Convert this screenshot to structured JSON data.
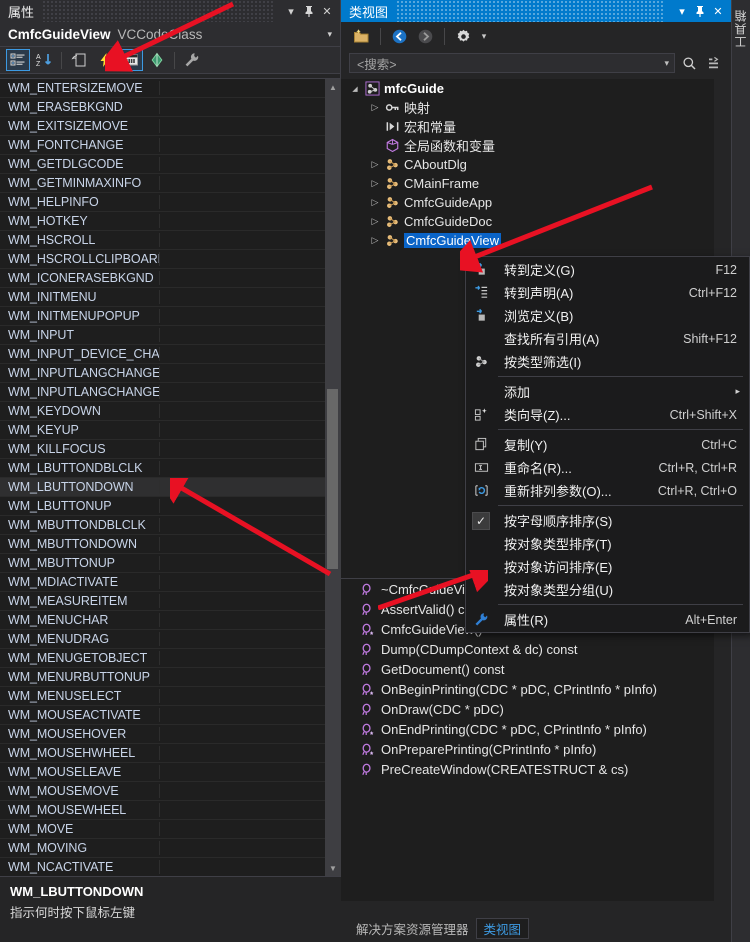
{
  "properties_pane": {
    "title": "属性",
    "titlebar_buttons": [
      {
        "name": "dropdown",
        "glyph": "▾"
      },
      {
        "name": "pin",
        "glyph": "⚲"
      },
      {
        "name": "close",
        "glyph": "✕"
      }
    ],
    "object_name": "CmfcGuideView",
    "object_type": "VCCodeClass",
    "object_caret": "▾",
    "toolbar": [
      {
        "name": "categorized-button",
        "selected": true
      },
      {
        "name": "alphabetical-sort-button",
        "selected": false
      },
      {
        "name": "properties-button",
        "selected": false
      },
      {
        "name": "events-button",
        "selected": false
      },
      {
        "name": "messages-button",
        "selected": true
      },
      {
        "name": "property-pages-button",
        "selected": false
      },
      {
        "name": "overrides-button",
        "selected": false
      }
    ],
    "rows": [
      {
        "name": "WM_ENTERSIZEMOVE",
        "value": ""
      },
      {
        "name": "WM_ERASEBKGND",
        "value": ""
      },
      {
        "name": "WM_EXITSIZEMOVE",
        "value": ""
      },
      {
        "name": "WM_FONTCHANGE",
        "value": ""
      },
      {
        "name": "WM_GETDLGCODE",
        "value": ""
      },
      {
        "name": "WM_GETMINMAXINFO",
        "value": ""
      },
      {
        "name": "WM_HELPINFO",
        "value": ""
      },
      {
        "name": "WM_HOTKEY",
        "value": ""
      },
      {
        "name": "WM_HSCROLL",
        "value": ""
      },
      {
        "name": "WM_HSCROLLCLIPBOARD",
        "value": ""
      },
      {
        "name": "WM_ICONERASEBKGND",
        "value": ""
      },
      {
        "name": "WM_INITMENU",
        "value": ""
      },
      {
        "name": "WM_INITMENUPOPUP",
        "value": ""
      },
      {
        "name": "WM_INPUT",
        "value": ""
      },
      {
        "name": "WM_INPUT_DEVICE_CHANGE",
        "value": ""
      },
      {
        "name": "WM_INPUTLANGCHANGE",
        "value": ""
      },
      {
        "name": "WM_INPUTLANGCHANGEREQUEST",
        "value": ""
      },
      {
        "name": "WM_KEYDOWN",
        "value": ""
      },
      {
        "name": "WM_KEYUP",
        "value": ""
      },
      {
        "name": "WM_KILLFOCUS",
        "value": ""
      },
      {
        "name": "WM_LBUTTONDBLCLK",
        "value": ""
      },
      {
        "name": "WM_LBUTTONDOWN",
        "value": "",
        "selected": true
      },
      {
        "name": "WM_LBUTTONUP",
        "value": ""
      },
      {
        "name": "WM_MBUTTONDBLCLK",
        "value": ""
      },
      {
        "name": "WM_MBUTTONDOWN",
        "value": ""
      },
      {
        "name": "WM_MBUTTONUP",
        "value": ""
      },
      {
        "name": "WM_MDIACTIVATE",
        "value": ""
      },
      {
        "name": "WM_MEASUREITEM",
        "value": ""
      },
      {
        "name": "WM_MENUCHAR",
        "value": ""
      },
      {
        "name": "WM_MENUDRAG",
        "value": ""
      },
      {
        "name": "WM_MENUGETOBJECT",
        "value": ""
      },
      {
        "name": "WM_MENURBUTTONUP",
        "value": ""
      },
      {
        "name": "WM_MENUSELECT",
        "value": ""
      },
      {
        "name": "WM_MOUSEACTIVATE",
        "value": ""
      },
      {
        "name": "WM_MOUSEHOVER",
        "value": ""
      },
      {
        "name": "WM_MOUSEHWHEEL",
        "value": ""
      },
      {
        "name": "WM_MOUSELEAVE",
        "value": ""
      },
      {
        "name": "WM_MOUSEMOVE",
        "value": ""
      },
      {
        "name": "WM_MOUSEWHEEL",
        "value": ""
      },
      {
        "name": "WM_MOVE",
        "value": ""
      },
      {
        "name": "WM_MOVING",
        "value": ""
      },
      {
        "name": "WM_NCACTIVATE",
        "value": ""
      }
    ],
    "scroll_up_glyph": "▲",
    "scroll_down_glyph": "▼",
    "description": {
      "title": "WM_LBUTTONDOWN",
      "body": "指示何时按下鼠标左键"
    }
  },
  "class_view": {
    "title": "类视图",
    "titlebar_buttons": [
      {
        "name": "dropdown",
        "glyph": "▾"
      },
      {
        "name": "pin",
        "glyph": "⚲"
      },
      {
        "name": "close",
        "glyph": "✕"
      }
    ],
    "toolbar": [
      {
        "name": "new-folder-button"
      },
      {
        "name": "back-button"
      },
      {
        "name": "forward-button"
      },
      {
        "name": "settings-button"
      }
    ],
    "search": {
      "placeholder": "<搜索>",
      "dropdown_glyph": "▾",
      "search_icon_name": "search-icon",
      "list-icon_name": "list-options-icon"
    },
    "tree": [
      {
        "label": "mfcGuide",
        "depth": 0,
        "twisty": "expanded",
        "icon": "project-icon",
        "bold": true
      },
      {
        "label": "映射",
        "depth": 1,
        "twisty": "collapsed",
        "icon": "key-icon"
      },
      {
        "label": "宏和常量",
        "depth": 1,
        "twisty": "none",
        "icon": "macro-icon"
      },
      {
        "label": "全局函数和变量",
        "depth": 1,
        "twisty": "none",
        "icon": "globals-icon"
      },
      {
        "label": "CAboutDlg",
        "depth": 1,
        "twisty": "collapsed",
        "icon": "class-icon"
      },
      {
        "label": "CMainFrame",
        "depth": 1,
        "twisty": "collapsed",
        "icon": "class-icon"
      },
      {
        "label": "CmfcGuideApp",
        "depth": 1,
        "twisty": "collapsed",
        "icon": "class-icon"
      },
      {
        "label": "CmfcGuideDoc",
        "depth": 1,
        "twisty": "collapsed",
        "icon": "class-icon"
      },
      {
        "label": "CmfcGuideView",
        "depth": 1,
        "twisty": "collapsed",
        "icon": "class-icon",
        "selected": true
      }
    ],
    "members": [
      {
        "label": "~CmfcGuideView()",
        "icon": "method-icon"
      },
      {
        "label": "AssertValid() const",
        "icon": "method-icon"
      },
      {
        "label": "CmfcGuideView()",
        "icon": "method-protected-icon"
      },
      {
        "label": "Dump(CDumpContext & dc) const",
        "icon": "method-icon"
      },
      {
        "label": "GetDocument() const",
        "icon": "method-icon"
      },
      {
        "label": "OnBeginPrinting(CDC * pDC, CPrintInfo * pInfo)",
        "icon": "method-protected-icon"
      },
      {
        "label": "OnDraw(CDC * pDC)",
        "icon": "method-icon"
      },
      {
        "label": "OnEndPrinting(CDC * pDC, CPrintInfo * pInfo)",
        "icon": "method-protected-icon"
      },
      {
        "label": "OnPreparePrinting(CPrintInfo * pInfo)",
        "icon": "method-protected-icon"
      },
      {
        "label": "PreCreateWindow(CREATESTRUCT & cs)",
        "icon": "method-icon"
      }
    ],
    "tabs": [
      {
        "label": "解决方案资源管理器",
        "active": false
      },
      {
        "label": "类视图",
        "active": true
      }
    ]
  },
  "dock": {
    "tabs": [
      {
        "label": "工具箱"
      }
    ]
  },
  "context_menu": {
    "items": [
      {
        "label": "转到定义(G)",
        "accel": "F12",
        "icon": "goto-definition-icon",
        "type": "item"
      },
      {
        "label": "转到声明(A)",
        "accel": "Ctrl+F12",
        "icon": "goto-declaration-icon",
        "type": "item"
      },
      {
        "label": "浏览定义(B)",
        "accel": "",
        "icon": "browse-definition-icon",
        "type": "item"
      },
      {
        "label": "查找所有引用(A)",
        "accel": "Shift+F12",
        "icon": "",
        "type": "item"
      },
      {
        "label": "按类型筛选(I)",
        "accel": "",
        "icon": "class-icon",
        "type": "item"
      },
      {
        "type": "separator"
      },
      {
        "label": "添加",
        "accel": "",
        "icon": "",
        "type": "submenu",
        "submenu_glyph": "▸"
      },
      {
        "label": "类向导(Z)...",
        "accel": "Ctrl+Shift+X",
        "icon": "class-wizard-icon",
        "type": "item"
      },
      {
        "type": "separator"
      },
      {
        "label": "复制(Y)",
        "accel": "Ctrl+C",
        "icon": "copy-icon",
        "type": "item"
      },
      {
        "label": "重命名(R)...",
        "accel": "Ctrl+R, Ctrl+R",
        "icon": "rename-icon",
        "type": "item"
      },
      {
        "label": "重新排列参数(O)...",
        "accel": "Ctrl+R, Ctrl+O",
        "icon": "reorder-params-icon",
        "type": "item"
      },
      {
        "type": "separator"
      },
      {
        "label": "按字母顺序排序(S)",
        "accel": "",
        "icon": "check-icon",
        "type": "item",
        "checked": true
      },
      {
        "label": "按对象类型排序(T)",
        "accel": "",
        "icon": "",
        "type": "item"
      },
      {
        "label": "按对象访问排序(E)",
        "accel": "",
        "icon": "",
        "type": "item"
      },
      {
        "label": "按对象类型分组(U)",
        "accel": "",
        "icon": "",
        "type": "item"
      },
      {
        "type": "separator"
      },
      {
        "label": "属性(R)",
        "accel": "Alt+Enter",
        "icon": "wrench-icon",
        "type": "item"
      }
    ]
  },
  "annotations": {
    "arrows": [
      {
        "name": "arrow-to-properties-toolbar"
      },
      {
        "name": "arrow-to-class-view-node"
      },
      {
        "name": "arrow-to-wm-lbuttondown-row"
      },
      {
        "name": "arrow-to-properties-menu-item"
      }
    ]
  },
  "colors": {
    "accent": "#007acc",
    "selection": "#0a64c8",
    "panel_bg": "#252526",
    "content_bg": "#1e1e1e",
    "menu_bg": "#1b1b1c",
    "annotation_red": "#e81123"
  }
}
